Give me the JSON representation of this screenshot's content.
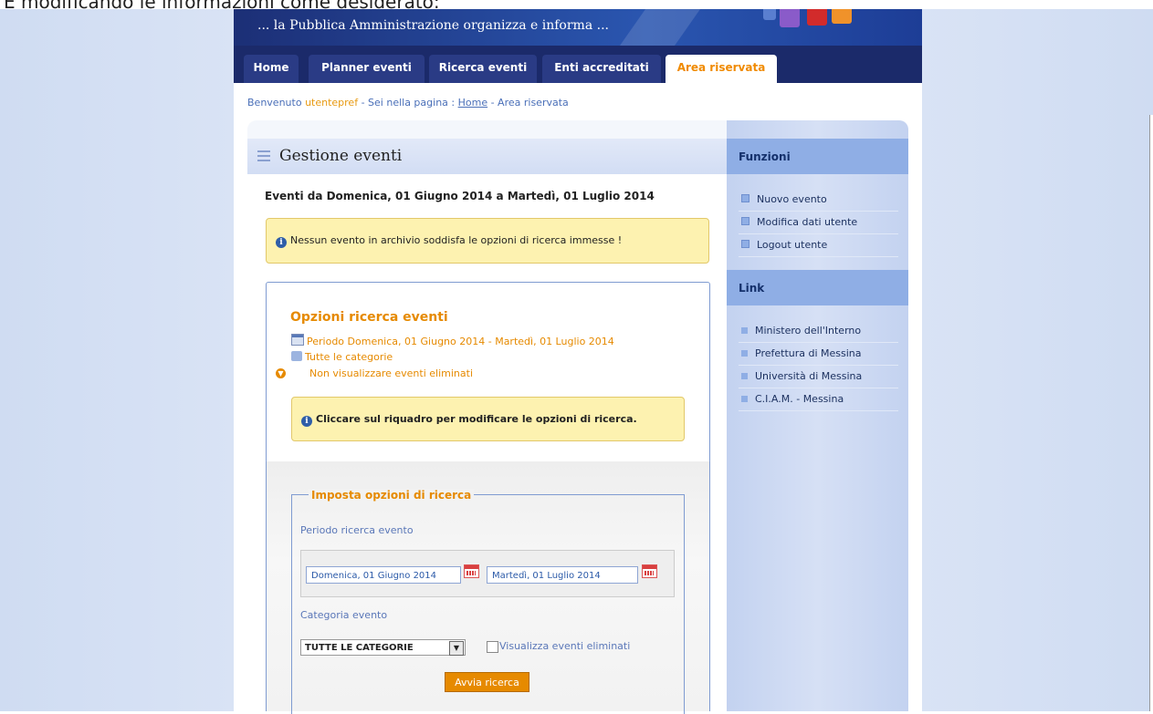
{
  "page_caption": "E modificando le informazioni come desiderato:",
  "banner": {
    "slogan": "... la Pubblica Amministrazione organizza e informa ..."
  },
  "nav": {
    "tabs": [
      {
        "label": "Home"
      },
      {
        "label": "Planner eventi"
      },
      {
        "label": "Ricerca eventi"
      },
      {
        "label": "Enti accreditati"
      },
      {
        "label": "Area riservata",
        "active": true
      }
    ]
  },
  "breadcrumb": {
    "welcome": "Benvenuto",
    "username": "utentepref",
    "sep": " - Sei nella pagina : ",
    "home": "Home",
    "current": " - Area riservata"
  },
  "main": {
    "title": "Gestione eventi",
    "range_heading": "Eventi da Domenica, 01 Giugno 2014 a Martedì, 01 Luglio 2014",
    "no_results": "Nessun evento in archivio soddisfa le opzioni di ricerca immesse !",
    "options": {
      "title": "Opzioni ricerca eventi",
      "period": "Periodo Domenica, 01 Giugno 2014 - Martedì, 01 Luglio 2014",
      "categories": "Tutte le categorie",
      "deleted": "Non visualizzare eventi eliminati",
      "hint": "Cliccare sul riquadro per modificare le opzioni di ricerca."
    },
    "search_form": {
      "legend": "Imposta opzioni di ricerca",
      "period_label": "Periodo ricerca evento",
      "date_from": "Domenica, 01 Giugno 2014",
      "date_to": "Martedì, 01 Luglio 2014",
      "category_label": "Categoria evento",
      "category_value": "TUTTE LE CATEGORIE",
      "show_deleted_label": "Visualizza eventi eliminati",
      "show_deleted_checked": false,
      "submit": "Avvia ricerca"
    }
  },
  "sidebar": {
    "functions_title": "Funzioni",
    "functions": [
      {
        "label": "Nuovo evento"
      },
      {
        "label": "Modifica dati utente"
      },
      {
        "label": "Logout utente"
      }
    ],
    "links_title": "Link",
    "links": [
      {
        "label": "Ministero dell'Interno"
      },
      {
        "label": "Prefettura di Messina"
      },
      {
        "label": "Università di Messina"
      },
      {
        "label": "C.I.A.M. - Messina"
      }
    ]
  },
  "colors": {
    "accent": "#e68a00",
    "nav_bg": "#1b2a6a",
    "panel_blue": "#8faee5",
    "warning_bg": "#fdf2b0"
  }
}
